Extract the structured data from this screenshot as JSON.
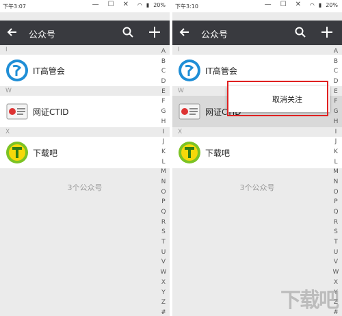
{
  "left": {
    "status_time": "下午3:07",
    "battery": "20%",
    "title": "公众号",
    "sections": [
      {
        "letter": "I",
        "name": "IT高管会"
      },
      {
        "letter": "W",
        "name": "网证CTID"
      },
      {
        "letter": "X",
        "name": "下载吧"
      }
    ],
    "count": "3个公众号"
  },
  "right": {
    "status_time": "下午3:10",
    "battery": "20%",
    "title": "公众号",
    "sections": [
      {
        "letter": "I",
        "name": "IT高管会"
      },
      {
        "letter": "W",
        "name": "网证CTID"
      },
      {
        "letter": "X",
        "name": "下载吧"
      }
    ],
    "count": "3个公众号",
    "popup_item": "取消关注"
  },
  "index_letters": [
    "A",
    "B",
    "C",
    "D",
    "E",
    "F",
    "G",
    "H",
    "I",
    "J",
    "K",
    "L",
    "M",
    "N",
    "O",
    "P",
    "Q",
    "R",
    "S",
    "T",
    "U",
    "V",
    "W",
    "X",
    "Y",
    "Z",
    "#"
  ],
  "colors": {
    "toolbar": "#393a3f",
    "background": "#ebebeb",
    "highlight": "#e02020"
  },
  "watermark": "下载吧"
}
